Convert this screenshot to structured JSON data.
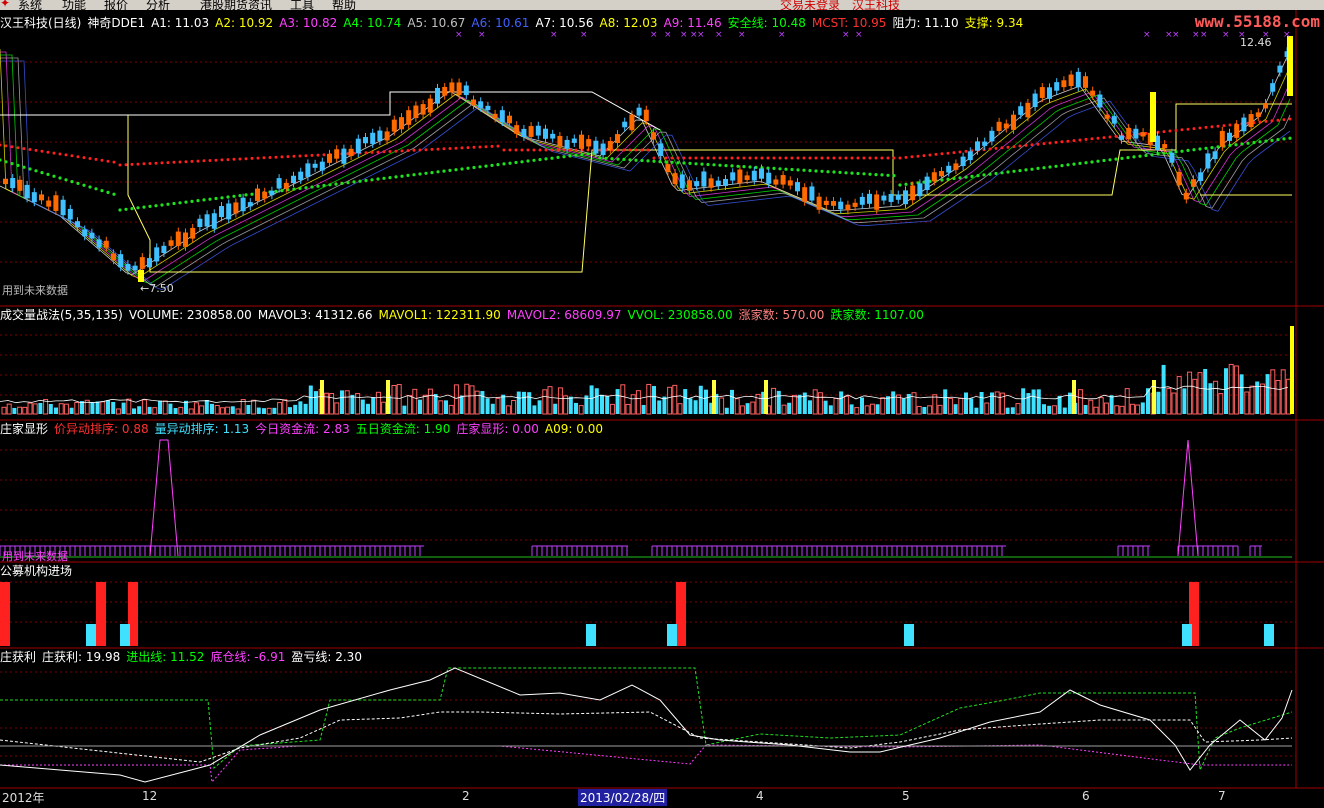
{
  "menu": {
    "items": [
      "系统",
      "功能",
      "报价",
      "分析",
      "港股期货",
      "资讯",
      "工具",
      "帮助"
    ],
    "alert": "交易未登录",
    "company": "汉王科技"
  },
  "logo": "www.55188.com",
  "price_header": {
    "title": "汉王科技(日线)",
    "indicator": "神奇DDE1",
    "values": [
      {
        "k": "A1:",
        "v": "11.03",
        "color": "#ffffff"
      },
      {
        "k": "A2:",
        "v": "10.92",
        "color": "#ffff00"
      },
      {
        "k": "A3:",
        "v": "10.82",
        "color": "#ff40ff"
      },
      {
        "k": "A4:",
        "v": "10.74",
        "color": "#00ff00"
      },
      {
        "k": "A5:",
        "v": "10.67",
        "color": "#c0c0c0"
      },
      {
        "k": "A6:",
        "v": "10.61",
        "color": "#4060ff"
      },
      {
        "k": "A7:",
        "v": "10.56",
        "color": "#ffffff"
      },
      {
        "k": "A8:",
        "v": "12.03",
        "color": "#ffff00"
      },
      {
        "k": "A9:",
        "v": "11.46",
        "color": "#ff40ff"
      },
      {
        "k": "安全线:",
        "v": "10.48",
        "color": "#00ff00"
      },
      {
        "k": "MCST:",
        "v": "10.95",
        "color": "#ff3030"
      },
      {
        "k": "阻力:",
        "v": "11.10",
        "color": "#ffffff"
      },
      {
        "k": "支撑:",
        "v": "9.34",
        "color": "#ffff00"
      }
    ],
    "high_label": "12.46",
    "low_label": "←7.50",
    "note": "用到未来数据"
  },
  "volume_header": {
    "title": "成交量战法(5,35,135)",
    "values": [
      {
        "k": "VOLUME:",
        "v": "230858.00",
        "color": "#ffffff"
      },
      {
        "k": "MAVOL3:",
        "v": "41312.66",
        "color": "#ffffff"
      },
      {
        "k": "MAVOL1:",
        "v": "122311.90",
        "color": "#ffff00"
      },
      {
        "k": "MAVOL2:",
        "v": "68609.97",
        "color": "#ff40ff"
      },
      {
        "k": "VVOL:",
        "v": "230858.00",
        "color": "#00ff00"
      },
      {
        "k": "涨家数:",
        "v": "570.00",
        "color": "#ff8080"
      },
      {
        "k": "跌家数:",
        "v": "1107.00",
        "color": "#00ff00"
      }
    ]
  },
  "zhuang_header": {
    "title": "庄家显形",
    "values": [
      {
        "k": "价异动排序:",
        "v": "0.88",
        "color": "#ff3030"
      },
      {
        "k": "量异动排序:",
        "v": "1.13",
        "color": "#40e0ff"
      },
      {
        "k": "今日资金流:",
        "v": "2.83",
        "color": "#ff40ff"
      },
      {
        "k": "五日资金流:",
        "v": "1.90",
        "color": "#00ff00"
      },
      {
        "k": "庄家显形:",
        "v": "0.00",
        "color": "#ff40ff"
      },
      {
        "k": "A09:",
        "v": "0.00",
        "color": "#ffff00"
      }
    ],
    "note": "用到未来数据"
  },
  "fund_header": {
    "title": "公募机构进场"
  },
  "profit_header": {
    "title": "庄获利",
    "values": [
      {
        "k": "庄获利:",
        "v": "19.98",
        "color": "#ffffff"
      },
      {
        "k": "进出线:",
        "v": "11.52",
        "color": "#00ff00"
      },
      {
        "k": "底仓线:",
        "v": "-6.91",
        "color": "#ff40ff"
      },
      {
        "k": "盈亏线:",
        "v": "2.30",
        "color": "#ffffff"
      }
    ]
  },
  "x_axis": {
    "labels": [
      "2012年",
      "12",
      "2",
      "2013/02/28/四",
      "4",
      "5",
      "6",
      "7"
    ],
    "selected": "2013/02/28/四"
  },
  "colors": {
    "up": "#ff6a00",
    "down": "#40c0ff",
    "grid": "#800000"
  }
}
